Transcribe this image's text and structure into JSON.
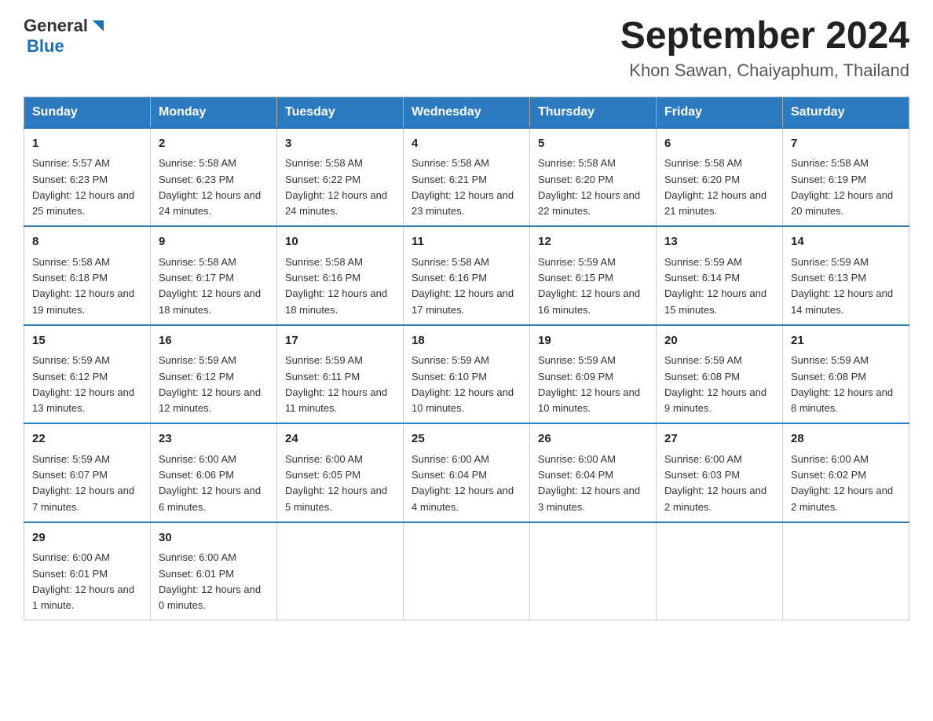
{
  "header": {
    "logo_general": "General",
    "logo_blue": "Blue",
    "title": "September 2024",
    "subtitle": "Khon Sawan, Chaiyaphum, Thailand"
  },
  "weekdays": [
    "Sunday",
    "Monday",
    "Tuesday",
    "Wednesday",
    "Thursday",
    "Friday",
    "Saturday"
  ],
  "weeks": [
    [
      {
        "day": "1",
        "sunrise": "5:57 AM",
        "sunset": "6:23 PM",
        "daylight": "12 hours and 25 minutes."
      },
      {
        "day": "2",
        "sunrise": "5:58 AM",
        "sunset": "6:23 PM",
        "daylight": "12 hours and 24 minutes."
      },
      {
        "day": "3",
        "sunrise": "5:58 AM",
        "sunset": "6:22 PM",
        "daylight": "12 hours and 24 minutes."
      },
      {
        "day": "4",
        "sunrise": "5:58 AM",
        "sunset": "6:21 PM",
        "daylight": "12 hours and 23 minutes."
      },
      {
        "day": "5",
        "sunrise": "5:58 AM",
        "sunset": "6:20 PM",
        "daylight": "12 hours and 22 minutes."
      },
      {
        "day": "6",
        "sunrise": "5:58 AM",
        "sunset": "6:20 PM",
        "daylight": "12 hours and 21 minutes."
      },
      {
        "day": "7",
        "sunrise": "5:58 AM",
        "sunset": "6:19 PM",
        "daylight": "12 hours and 20 minutes."
      }
    ],
    [
      {
        "day": "8",
        "sunrise": "5:58 AM",
        "sunset": "6:18 PM",
        "daylight": "12 hours and 19 minutes."
      },
      {
        "day": "9",
        "sunrise": "5:58 AM",
        "sunset": "6:17 PM",
        "daylight": "12 hours and 18 minutes."
      },
      {
        "day": "10",
        "sunrise": "5:58 AM",
        "sunset": "6:16 PM",
        "daylight": "12 hours and 18 minutes."
      },
      {
        "day": "11",
        "sunrise": "5:58 AM",
        "sunset": "6:16 PM",
        "daylight": "12 hours and 17 minutes."
      },
      {
        "day": "12",
        "sunrise": "5:59 AM",
        "sunset": "6:15 PM",
        "daylight": "12 hours and 16 minutes."
      },
      {
        "day": "13",
        "sunrise": "5:59 AM",
        "sunset": "6:14 PM",
        "daylight": "12 hours and 15 minutes."
      },
      {
        "day": "14",
        "sunrise": "5:59 AM",
        "sunset": "6:13 PM",
        "daylight": "12 hours and 14 minutes."
      }
    ],
    [
      {
        "day": "15",
        "sunrise": "5:59 AM",
        "sunset": "6:12 PM",
        "daylight": "12 hours and 13 minutes."
      },
      {
        "day": "16",
        "sunrise": "5:59 AM",
        "sunset": "6:12 PM",
        "daylight": "12 hours and 12 minutes."
      },
      {
        "day": "17",
        "sunrise": "5:59 AM",
        "sunset": "6:11 PM",
        "daylight": "12 hours and 11 minutes."
      },
      {
        "day": "18",
        "sunrise": "5:59 AM",
        "sunset": "6:10 PM",
        "daylight": "12 hours and 10 minutes."
      },
      {
        "day": "19",
        "sunrise": "5:59 AM",
        "sunset": "6:09 PM",
        "daylight": "12 hours and 10 minutes."
      },
      {
        "day": "20",
        "sunrise": "5:59 AM",
        "sunset": "6:08 PM",
        "daylight": "12 hours and 9 minutes."
      },
      {
        "day": "21",
        "sunrise": "5:59 AM",
        "sunset": "6:08 PM",
        "daylight": "12 hours and 8 minutes."
      }
    ],
    [
      {
        "day": "22",
        "sunrise": "5:59 AM",
        "sunset": "6:07 PM",
        "daylight": "12 hours and 7 minutes."
      },
      {
        "day": "23",
        "sunrise": "6:00 AM",
        "sunset": "6:06 PM",
        "daylight": "12 hours and 6 minutes."
      },
      {
        "day": "24",
        "sunrise": "6:00 AM",
        "sunset": "6:05 PM",
        "daylight": "12 hours and 5 minutes."
      },
      {
        "day": "25",
        "sunrise": "6:00 AM",
        "sunset": "6:04 PM",
        "daylight": "12 hours and 4 minutes."
      },
      {
        "day": "26",
        "sunrise": "6:00 AM",
        "sunset": "6:04 PM",
        "daylight": "12 hours and 3 minutes."
      },
      {
        "day": "27",
        "sunrise": "6:00 AM",
        "sunset": "6:03 PM",
        "daylight": "12 hours and 2 minutes."
      },
      {
        "day": "28",
        "sunrise": "6:00 AM",
        "sunset": "6:02 PM",
        "daylight": "12 hours and 2 minutes."
      }
    ],
    [
      {
        "day": "29",
        "sunrise": "6:00 AM",
        "sunset": "6:01 PM",
        "daylight": "12 hours and 1 minute."
      },
      {
        "day": "30",
        "sunrise": "6:00 AM",
        "sunset": "6:01 PM",
        "daylight": "12 hours and 0 minutes."
      },
      null,
      null,
      null,
      null,
      null
    ]
  ]
}
